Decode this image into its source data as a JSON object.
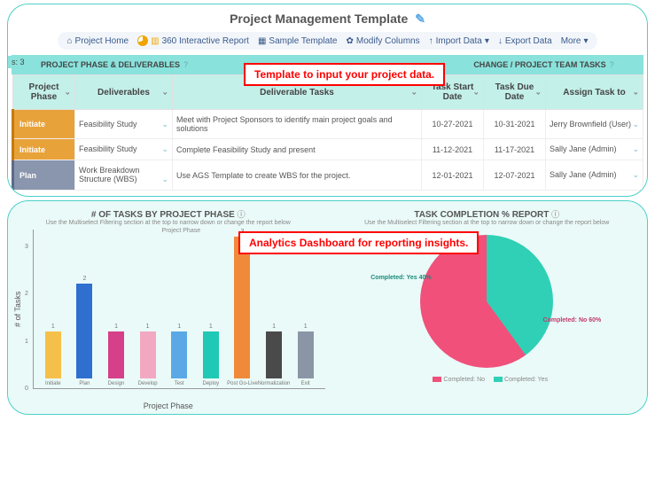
{
  "header": {
    "title": "Project Management Template",
    "toolbar": {
      "home": "Project Home",
      "report": "360 Interactive Report",
      "sample": "Sample Template",
      "modify": "Modify Columns",
      "import": "Import Data",
      "export": "Export Data",
      "more": "More"
    },
    "rows_tag": "s: 3",
    "annotation1": "Template to input your project data.",
    "section1": "PROJECT PHASE & DELIVERABLES",
    "section3": "CHANGE / PROJECT TEAM TASKS",
    "help": "?"
  },
  "columns": {
    "c1": "Project Phase",
    "c2": "Deliverables",
    "c3": "Deliverable Tasks",
    "c4": "Task Start Date",
    "c5": "Task Due Date",
    "c6": "Assign Task to"
  },
  "rows": [
    {
      "phase": "Initiate",
      "phaseClass": "phase-initiate",
      "deliv": "Feasibility Study",
      "task": "Meet with Project Sponsors to identify main project goals and solutions",
      "start": "10-27-2021",
      "due": "10-31-2021",
      "assign": "Jerry Brownfield (User)"
    },
    {
      "phase": "Initiate",
      "phaseClass": "phase-initiate",
      "deliv": "Feasibility Study",
      "task": "Complete Feasibility Study and present",
      "start": "11-12-2021",
      "due": "11-17-2021",
      "assign": "Sally Jane (Admin)"
    },
    {
      "phase": "Plan",
      "phaseClass": "phase-plan",
      "deliv": "Work Breakdown Structure (WBS)",
      "task": "Use AGS Template to create WBS for the project.",
      "start": "12-01-2021",
      "due": "12-07-2021",
      "assign": "Sally Jane (Admin)"
    }
  ],
  "analytics": {
    "annotation2": "Analytics Dashboard for reporting insights.",
    "bar": {
      "title": "# OF TASKS BY PROJECT PHASE",
      "sub": "Use the Multiselect Filtering section at the top to narrow down or change the report below",
      "ylabel": "# of Tasks",
      "xlabel": "Project Phase",
      "legend": "Project Phase"
    },
    "pie": {
      "title": "TASK COMPLETION % REPORT",
      "sub": "Use the Multiselect Filtering section at the top to narrow down or change the report below",
      "yes_label": "Completed: Yes 40%",
      "no_label": "Completed: No 60%",
      "legend_no": "Completed: No",
      "legend_yes": "Completed: Yes"
    }
  },
  "chart_data": [
    {
      "type": "bar",
      "title": "# OF TASKS BY PROJECT PHASE",
      "xlabel": "Project Phase",
      "ylabel": "# of Tasks",
      "ylim": [
        0,
        3
      ],
      "categories": [
        "Initiate",
        "Plan",
        "Design",
        "Develop",
        "Test",
        "Deploy",
        "Post Go-Live",
        "Normalization",
        "Exit"
      ],
      "values": [
        1,
        2,
        1,
        1,
        1,
        1,
        3,
        1,
        1
      ],
      "colors": [
        "#f5c04a",
        "#2f6fd0",
        "#d63f8a",
        "#f2a8c0",
        "#5aa9e6",
        "#1fc9b5",
        "#f08a3a",
        "#4a4a4a",
        "#8a96a6"
      ]
    },
    {
      "type": "pie",
      "title": "TASK COMPLETION % REPORT",
      "series": [
        {
          "name": "Completed: Yes",
          "value": 40,
          "color": "#2fd0b5"
        },
        {
          "name": "Completed: No",
          "value": 60,
          "color": "#f0507a"
        }
      ]
    }
  ]
}
